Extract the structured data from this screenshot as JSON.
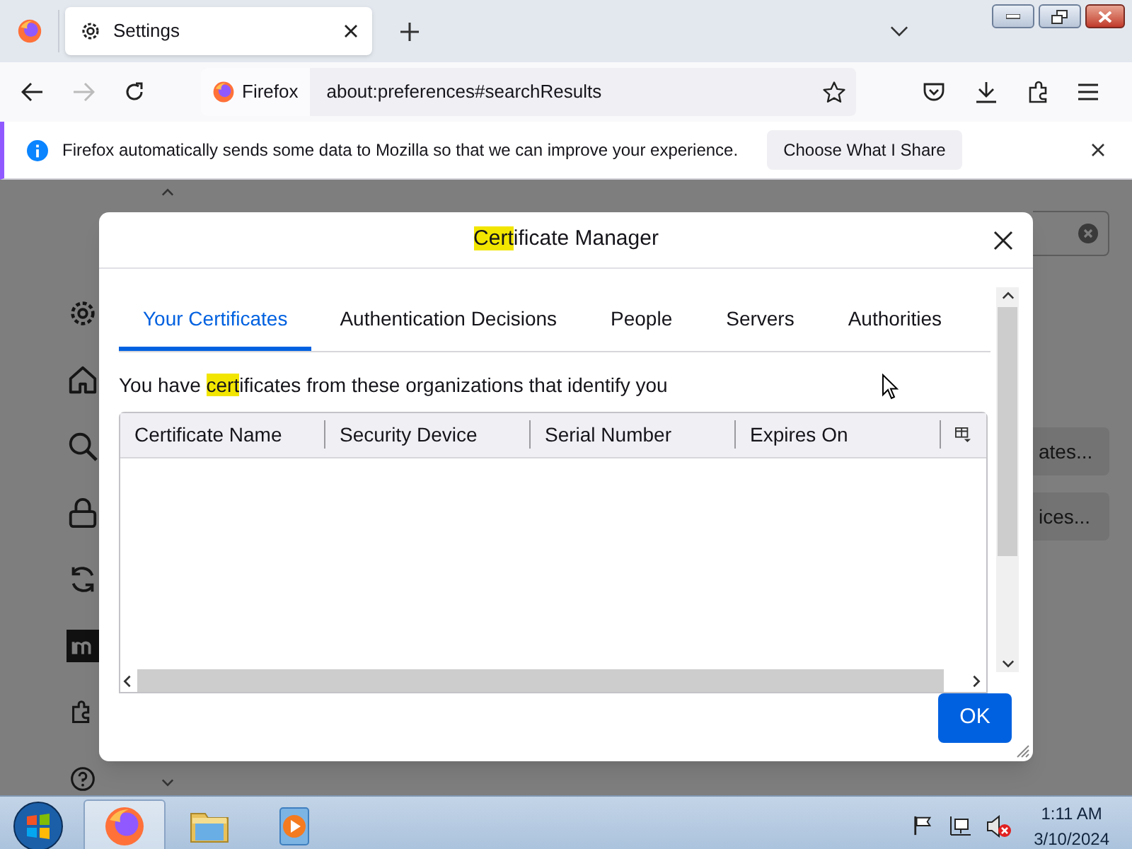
{
  "browser": {
    "tab": {
      "title": "Settings"
    },
    "url_bar": {
      "identity": "Firefox",
      "url": "about:preferences#searchResults"
    }
  },
  "notification": {
    "message": "Firefox automatically sends some data to Mozilla so that we can improve your experience.",
    "button": "Choose What I Share"
  },
  "background": {
    "buttons": [
      "ates...",
      "ices..."
    ]
  },
  "dialog": {
    "title": [
      {
        "text": "Cert",
        "highlighted": true
      },
      {
        "text": "ificate Manager",
        "highlighted": false
      }
    ],
    "tabs": [
      {
        "label": "Your Certificates",
        "selected": true
      },
      {
        "label": "Authentication Decisions",
        "selected": false
      },
      {
        "label": "People",
        "selected": false
      },
      {
        "label": "Servers",
        "selected": false
      },
      {
        "label": "Authorities",
        "selected": false
      }
    ],
    "description": [
      {
        "text": "You have ",
        "highlighted": false
      },
      {
        "text": "cert",
        "highlighted": true
      },
      {
        "text": "ificates from these organizations that identify you",
        "highlighted": false
      }
    ],
    "table": {
      "columns": [
        "Certificate Name",
        "Security Device",
        "Serial Number",
        "Expires On"
      ]
    },
    "ok_button": "OK"
  },
  "taskbar": {
    "apps": [
      {
        "kind": "firefox",
        "selected": true
      },
      {
        "kind": "explorer",
        "selected": false
      },
      {
        "kind": "media",
        "selected": false
      }
    ],
    "clock": {
      "time": "1:11 AM",
      "date": "3/10/2024"
    }
  }
}
